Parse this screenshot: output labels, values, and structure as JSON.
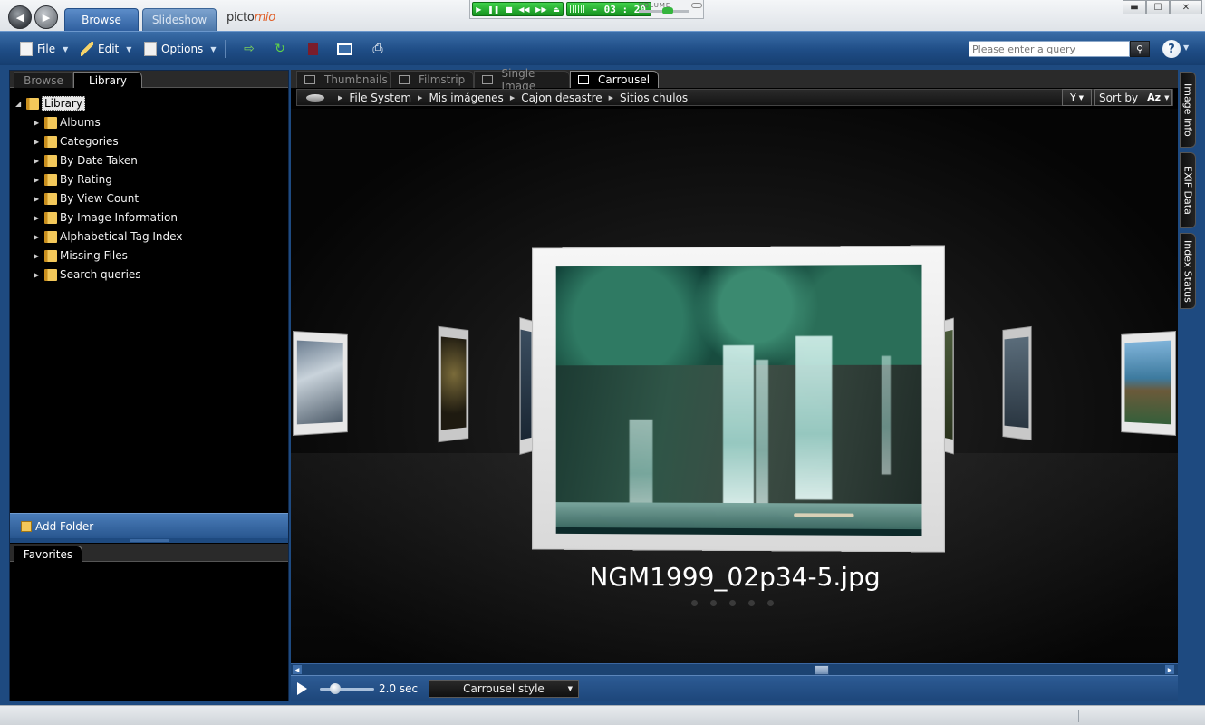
{
  "titlebar": {
    "tabs": {
      "browse": "Browse",
      "slideshow": "Slideshow"
    },
    "logo_a": "picto",
    "logo_b": "mio",
    "player": {
      "time": "- 03 : 20",
      "volume_label": "VOLUME"
    },
    "window": {
      "minimize": "▬",
      "maximize": "☐",
      "close": "✕"
    }
  },
  "toolbar": {
    "file": "File",
    "edit": "Edit",
    "options": "Options",
    "search_placeholder": "Please enter a query",
    "help": "?"
  },
  "left_panel": {
    "tabs": {
      "browse": "Browse",
      "library": "Library"
    },
    "tree": {
      "root": "Library",
      "items": [
        "Albums",
        "Categories",
        "By Date Taken",
        "By Rating",
        "By View Count",
        "By Image Information",
        "Alphabetical Tag Index",
        "Missing Files",
        "Search queries"
      ]
    },
    "add_folder": "Add Folder",
    "favorites_tab": "Favorites"
  },
  "viewer": {
    "tabs": [
      "Thumbnails",
      "Filmstrip",
      "Single Image",
      "Carrousel"
    ],
    "active_tab": "Carrousel",
    "breadcrumb": [
      "File System",
      "Mis imágenes",
      "Cajon desastre",
      "Sitios chulos"
    ],
    "filter": "Y",
    "sort_by": "Sort by",
    "sort_mode": "Az",
    "filename": "NGM1999_02p34-5.jpg",
    "slide_interval": "2.0 sec",
    "style_select": "Carrousel style"
  },
  "right_tabs": [
    "Image Info",
    "EXIF Data",
    "Index Status"
  ],
  "colors": {
    "frame_blue": "#1e4a80",
    "toolbar_blue": "#2f5f9f",
    "player_green": "#16931f",
    "logo_accent": "#e0602a"
  }
}
